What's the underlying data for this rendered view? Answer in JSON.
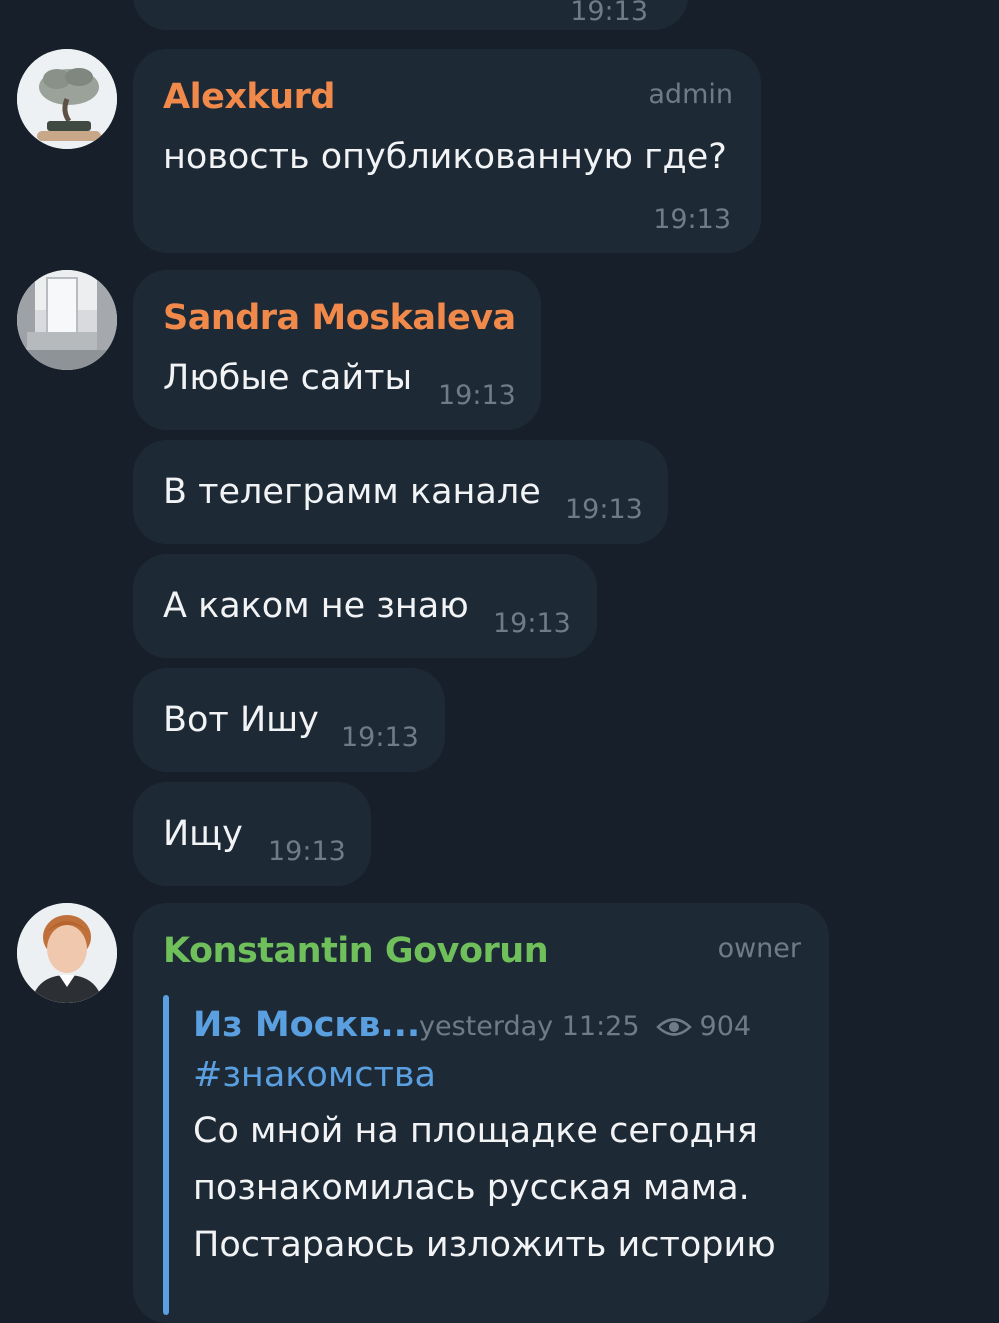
{
  "top_partial": {
    "time": "19:13"
  },
  "messages": [
    {
      "sender": "Alexkurd",
      "role": "admin",
      "text": "новость опубликованную где?",
      "time": "19:13"
    },
    {
      "sender": "Sandra Moskaleva",
      "items": [
        {
          "text": "Любые сайты",
          "time": "19:13"
        },
        {
          "text": "В телеграмм канале",
          "time": "19:13"
        },
        {
          "text": "А каком не знаю",
          "time": "19:13"
        },
        {
          "text": "Вот Ишу",
          "time": "19:13"
        },
        {
          "text": "Ищу",
          "time": "19:13"
        }
      ]
    },
    {
      "sender": "Konstantin Govorun",
      "role": "owner",
      "forward": {
        "channel": "Из Москв...",
        "date": "yesterday 11:25",
        "views": "904",
        "hashtag": "#знакомства",
        "lines": [
          "Со мной на площадке сегодня",
          "познакомилась русская мама.",
          "Постараюсь изложить историю"
        ]
      }
    }
  ],
  "colors": {
    "background": "#161f2a",
    "bubble": "#1e2936",
    "name_orange": "#f0894a",
    "name_green": "#6fbf5a",
    "link_blue": "#5aa0e0",
    "meta_gray": "#6f7c88"
  },
  "icons": [
    "eye-icon"
  ]
}
